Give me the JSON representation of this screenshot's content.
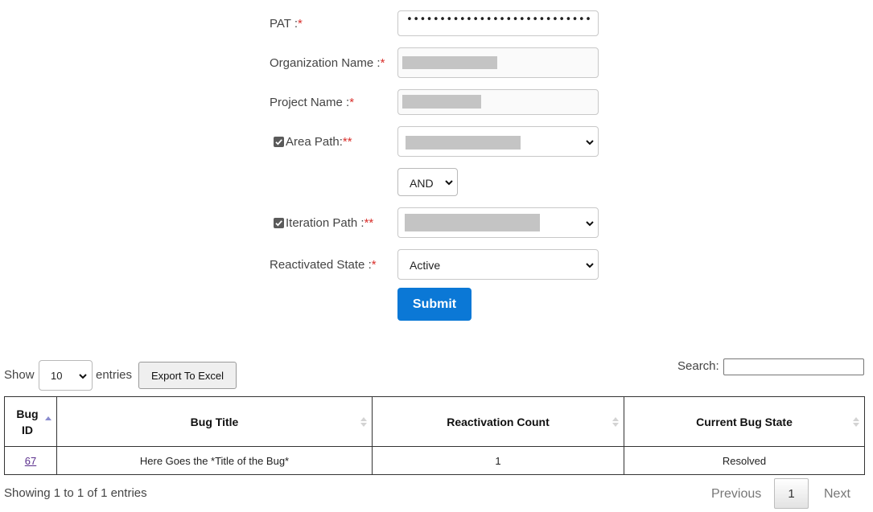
{
  "form": {
    "pat": {
      "label": "PAT :",
      "required": "*",
      "value": "••••••••••••••••••••••••••••••••••••••••••••••••••••••••"
    },
    "organization": {
      "label": "Organization Name :",
      "required": "*"
    },
    "project": {
      "label": "Project Name :",
      "required": "*"
    },
    "area_path": {
      "label": "Area Path:",
      "required": "**",
      "checked": true
    },
    "operator": {
      "value": "AND"
    },
    "iteration_path": {
      "label": "Iteration Path :",
      "required": "**",
      "checked": true
    },
    "reactivated_state": {
      "label": "Reactivated State :",
      "required": "*",
      "value": "Active"
    },
    "submit_label": "Submit"
  },
  "table_controls": {
    "show_label": "Show",
    "entries_value": "10",
    "entries_label": "entries",
    "export_label": "Export To Excel",
    "search_label": "Search:"
  },
  "table": {
    "columns": [
      "Bug ID",
      "Bug Title",
      "Reactivation Count",
      "Current Bug State"
    ],
    "rows": [
      {
        "id": "67",
        "title": "Here Goes the *Title of the Bug*",
        "count": "1",
        "state": "Resolved"
      }
    ]
  },
  "footer": {
    "info": "Showing 1 to 1 of 1 entries",
    "previous": "Previous",
    "page": "1",
    "next": "Next"
  },
  "colors": {
    "accent": "#0b78d6",
    "required": "#d9302c",
    "link_visited": "#5a2e8c"
  }
}
